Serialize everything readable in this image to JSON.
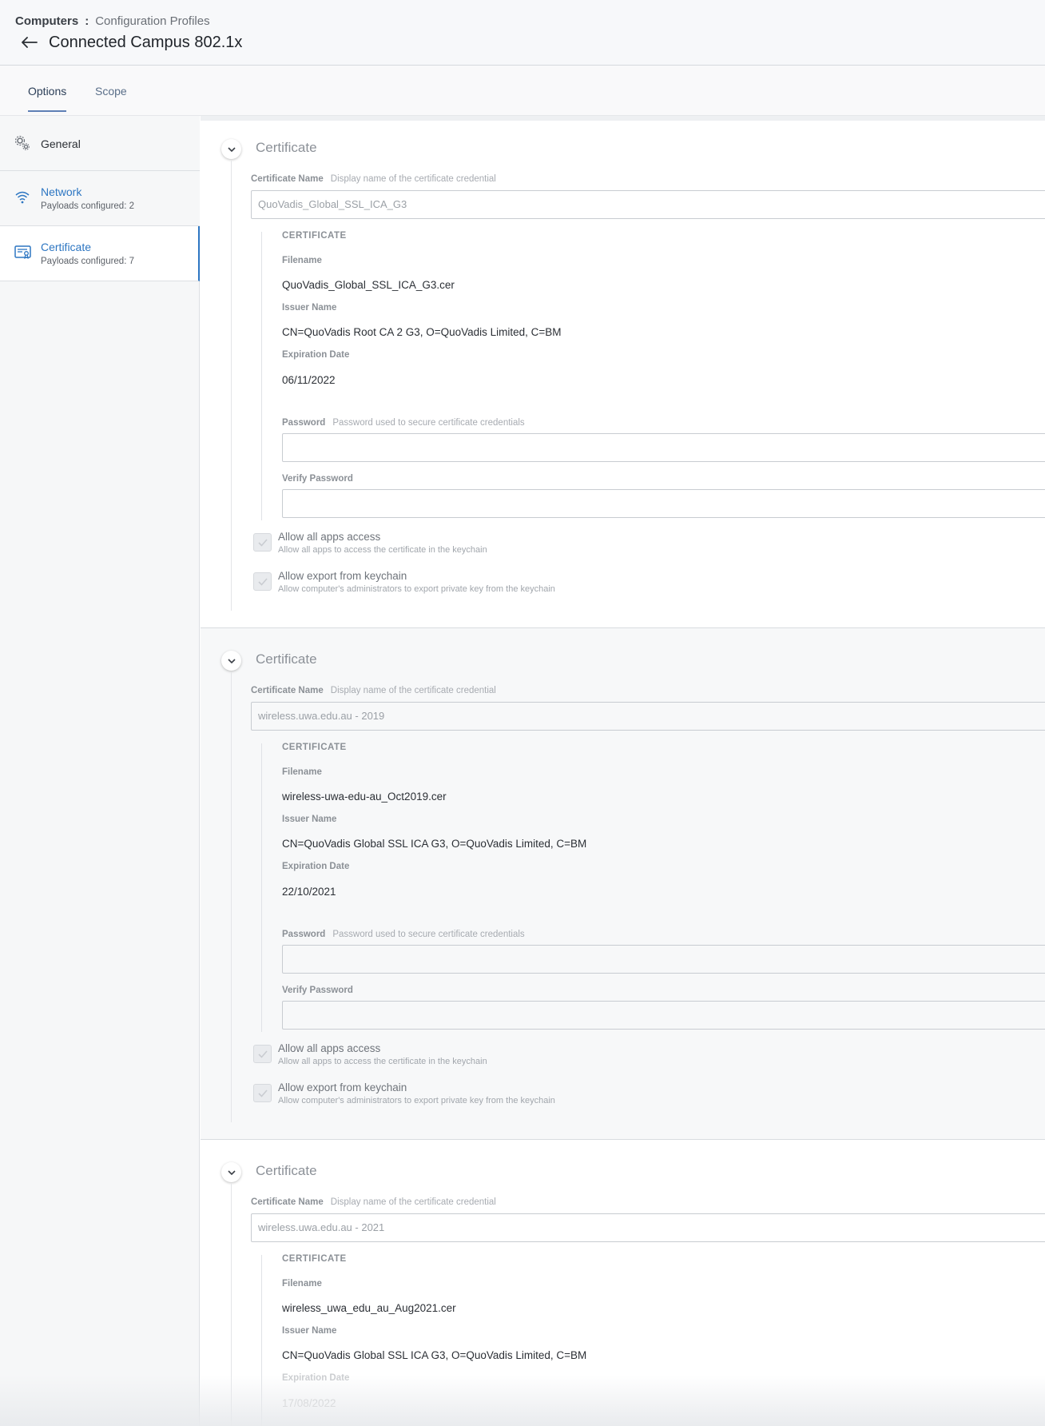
{
  "breadcrumb": {
    "root": "Computers",
    "separator": ":",
    "current": "Configuration Profiles"
  },
  "page": {
    "title": "Connected Campus 802.1x"
  },
  "tabs": [
    {
      "label": "Options",
      "active": true
    },
    {
      "label": "Scope",
      "active": false
    }
  ],
  "sidebar": {
    "items": [
      {
        "title": "General",
        "subtitle": "",
        "icon": "gear-icon"
      },
      {
        "title": "Network",
        "subtitle": "Payloads configured: 2",
        "icon": "wifi-icon"
      },
      {
        "title": "Certificate",
        "subtitle": "Payloads configured: 7",
        "icon": "certificate-icon",
        "active": true
      }
    ]
  },
  "labels": {
    "section_title": "Certificate",
    "cert_name_label": "Certificate Name",
    "cert_name_hint": "Display name of the certificate credential",
    "cert_heading": "CERTIFICATE",
    "filename_label": "Filename",
    "issuer_label": "Issuer Name",
    "expiration_label": "Expiration Date",
    "password_label": "Password",
    "password_hint": "Password used to secure certificate credentials",
    "verify_password_label": "Verify Password",
    "allow_apps_label": "Allow all apps access",
    "allow_apps_sub": "Allow all apps to access the certificate in the keychain",
    "allow_export_label": "Allow export from keychain",
    "allow_export_sub": "Allow computer's administrators to export private key from the keychain"
  },
  "certificates": [
    {
      "name": "QuoVadis_Global_SSL_ICA_G3",
      "filename": "QuoVadis_Global_SSL_ICA_G3.cer",
      "issuer": "CN=QuoVadis Root CA 2 G3, O=QuoVadis Limited, C=BM",
      "expiration": "06/11/2022",
      "password": "",
      "verify_password": "",
      "allow_all_apps": true,
      "allow_export": true
    },
    {
      "name": "wireless.uwa.edu.au - 2019",
      "filename": "wireless-uwa-edu-au_Oct2019.cer",
      "issuer": "CN=QuoVadis Global SSL ICA G3, O=QuoVadis Limited, C=BM",
      "expiration": "22/10/2021",
      "password": "",
      "verify_password": "",
      "allow_all_apps": true,
      "allow_export": true
    },
    {
      "name": "wireless.uwa.edu.au - 2021",
      "filename": "wireless_uwa_edu_au_Aug2021.cer",
      "issuer": "CN=QuoVadis Global SSL ICA G3, O=QuoVadis Limited, C=BM",
      "expiration": "17/08/2022"
    }
  ],
  "colors": {
    "accent": "#2d76c2",
    "tab_underline": "#5e7fb5",
    "header_bg": "#f7f8fa",
    "sidebar_bg": "#f6f7f8"
  }
}
